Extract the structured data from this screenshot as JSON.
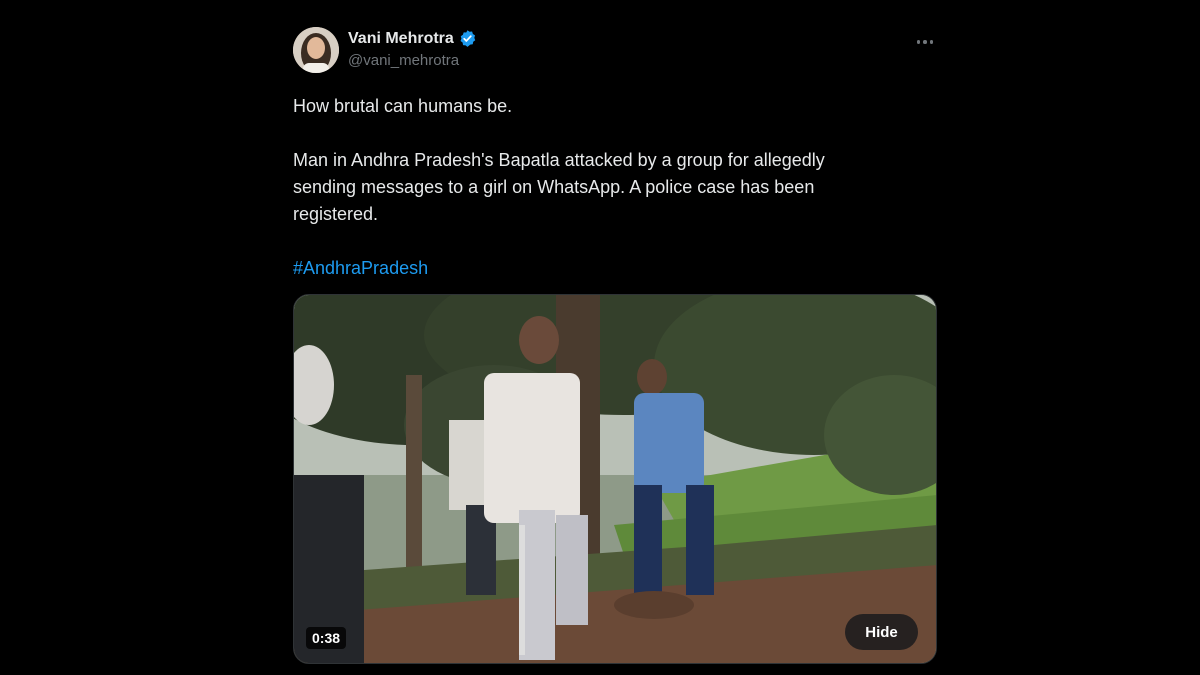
{
  "tweet": {
    "display_name": "Vani Mehrotra",
    "handle": "@vani_mehrotra",
    "verified": true,
    "verified_icon": "verified-badge-icon",
    "more_icon": "more-options-icon",
    "text": {
      "line1": "How brutal can humans be.",
      "para2_line1": "Man in Andhra Pradesh's Bapatla attacked by a group for allegedly",
      "para2_line2": "sending messages to a girl on WhatsApp. A police case has been",
      "para2_line3": "registered.",
      "hashtag": "#AndhraPradesh"
    },
    "media": {
      "duration": "0:38",
      "hide_label": "Hide"
    }
  },
  "colors": {
    "background": "#000000",
    "text": "#e7e9ea",
    "secondary": "#71767b",
    "accent": "#1d9bf0"
  }
}
